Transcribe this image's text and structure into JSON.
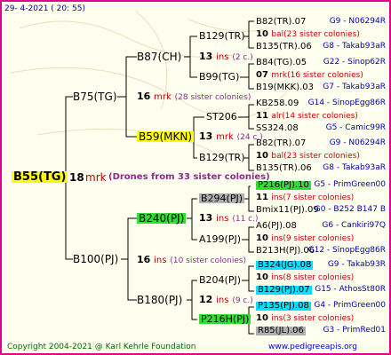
{
  "header": {
    "date": "29-  4-2021 ( 20: 55)"
  },
  "footer": {
    "copyright": "Copyright 2004-2021 @ Karl Kehrle Foundation",
    "site": "www.pedigreeapis.org"
  },
  "root": {
    "id": "B55(TG)",
    "count": "18",
    "label": "mrk",
    "note": "(Drones from 33 sister colonies)"
  },
  "g1": [
    {
      "id": "B75(TG)",
      "count": "16",
      "label": "mrk",
      "note": "(28 sister colonies)"
    },
    {
      "id": "B100(PJ)",
      "count": "16",
      "label": "ins",
      "note": "(10 sister colonies)"
    }
  ],
  "g2": [
    {
      "id": "B87(CH)",
      "count": "",
      "label": "",
      "note": ""
    },
    {
      "id": "B59(MKN)",
      "count": "13",
      "label": "mrk",
      "note": "(24 c.)"
    },
    {
      "id": "B240(PJ)",
      "count": "13",
      "label": "ins",
      "note": "(11 c.)"
    },
    {
      "id": "B180(PJ)",
      "count": "12",
      "label": "ins",
      "note": "(9 c.)"
    }
  ],
  "g3": [
    {
      "id": "B129(TR)",
      "count": "13",
      "label": "ins",
      "note": "(2 c.)"
    },
    {
      "id": "B99(TG)"
    },
    {
      "id": "ST206"
    },
    {
      "id": "B129(TR)"
    },
    {
      "id": "B294(PJ)"
    },
    {
      "id": "A199(PJ)"
    },
    {
      "id": "B204(PJ)"
    },
    {
      "id": "P216H(PJ)"
    }
  ],
  "g4": [
    {
      "id": "B82(TR).07",
      "rt": "G9 - N06294R"
    },
    {
      "count": "10",
      "label": "bal",
      "note": "(23 sister colonies)"
    },
    {
      "id": "B135(TR).06",
      "rt": "G8 - Takab93aR"
    },
    {
      "id": "B84(TG).05",
      "rt": "G22 - Sinop62R"
    },
    {
      "count": "07",
      "label": "mrk",
      "note": "(16 sister colonies)"
    },
    {
      "id": "B19(MKK).03",
      "rt": "G7 - Takab93aR"
    },
    {
      "id": "KB258.09",
      "rt": "G14 - SinopEgg86R"
    },
    {
      "count": "11",
      "label": "alr",
      "note": "(14 sister colonies)"
    },
    {
      "id": "SS324.08",
      "rt": "G5 - Camic99R"
    },
    {
      "id": "B82(TR).07",
      "rt": "G9 - N06294R"
    },
    {
      "count": "10",
      "label": "bal",
      "note": "(23 sister colonies)"
    },
    {
      "id": "B135(TR).06",
      "rt": "G8 - Takab93aR"
    },
    {
      "id": "P216(PJ).10",
      "rt": "G5 - PrimGreen00"
    },
    {
      "count": "11",
      "label": "ins",
      "note": "(7 sister colonies)"
    },
    {
      "id": "Bmix11(PJ).09",
      "rt": "G0 - B252 B147 B"
    },
    {
      "id": "A6(PJ).08",
      "rt": "G6 - Cankiri97Q"
    },
    {
      "count": "10",
      "label": "ins",
      "note": "(9 sister colonies)"
    },
    {
      "id": "B213H(PJ).06",
      "rt": "G12 - SinopEgg86R"
    },
    {
      "id": "B324(JG).08",
      "rt": "G9 - Takab93R"
    },
    {
      "count": "10",
      "label": "ins",
      "note": "(8 sister colonies)"
    },
    {
      "id": "B129(PJ).07",
      "rt": "G15 - AthosSt80R"
    },
    {
      "id": "P135(PJ).08",
      "rt": "G4 - PrimGreen00"
    },
    {
      "count": "10",
      "label": "ins",
      "note": "(3 sister colonies)"
    },
    {
      "id": "R85(JL).06",
      "rt": "G3 - PrimRed01"
    }
  ]
}
